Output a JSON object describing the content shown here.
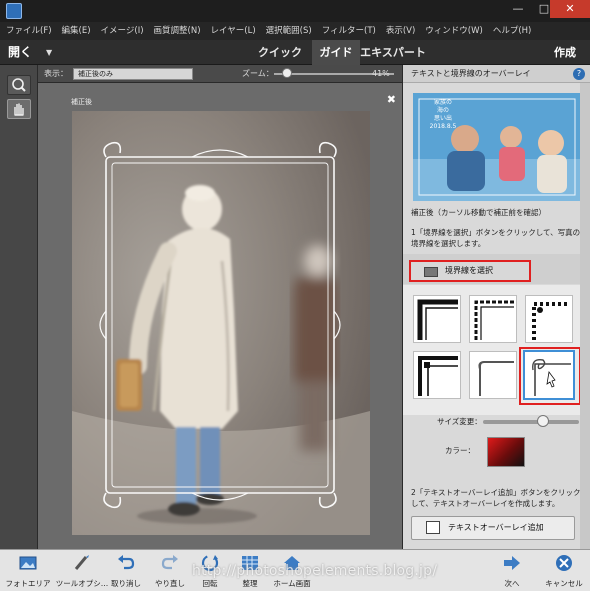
{
  "menu": [
    "ファイル(F)",
    "編集(E)",
    "イメージ(I)",
    "画質調整(N)",
    "レイヤー(L)",
    "選択範囲(S)",
    "フィルター(T)",
    "表示(V)",
    "ウィンドウ(W)",
    "ヘルプ(H)"
  ],
  "window_buttons": {
    "minimize": "—",
    "maximize": "□",
    "close": "✕"
  },
  "modebar": {
    "open": "開く",
    "open_arrow": "▼",
    "tabs": [
      "クイック",
      "ガイド",
      "エキスパート"
    ],
    "active_tab": "ガイド",
    "create": "作成"
  },
  "options": {
    "view_label": "表示：",
    "view_value": "補正後のみ",
    "zoom_label": "ズーム：",
    "zoom_value": "41%"
  },
  "zoom_level": 0.41,
  "document": {
    "label": "補正後",
    "close": "✖"
  },
  "panel": {
    "title": "テキストと境界線のオーバーレイ",
    "help": "?",
    "preview_text": [
      "家族の",
      "海の",
      "思い出",
      "2018.8.5"
    ],
    "caption": "補正後（カーソル移動で補正前を確認）",
    "step1": "1「境界線を選択」ボタンをクリックして、写真の境界線を選択します。",
    "select_frame": "境界線を選択",
    "size_label": "サイズ変更：",
    "color_label": "カラー：",
    "step2": "2「テキストオーバーレイ追加」ボタンをクリックして、テキストオーバーレイを作成します。",
    "add_text": "テキストオーバーレイ追加"
  },
  "size_slider_value": 0.62,
  "colors": {
    "accent": "#e02020",
    "selected": "#3f8fd6",
    "swatch": "#c01818"
  },
  "bottom": [
    {
      "label": "フォトエリア",
      "icon": "photo-bin-icon"
    },
    {
      "label": "ツールオプシ…",
      "icon": "tool-options-icon"
    },
    {
      "label": "取り消し",
      "icon": "undo-icon"
    },
    {
      "label": "やり直し",
      "icon": "redo-icon"
    },
    {
      "label": "回転",
      "icon": "rotate-icon"
    },
    {
      "label": "整理",
      "icon": "organize-icon"
    },
    {
      "label": "ホーム画面",
      "icon": "home-icon"
    },
    {
      "label": "次へ",
      "icon": "next-icon"
    },
    {
      "label": "キャンセル",
      "icon": "cancel-icon"
    }
  ],
  "watermark": "http://photoshopelements.blog.jp/"
}
